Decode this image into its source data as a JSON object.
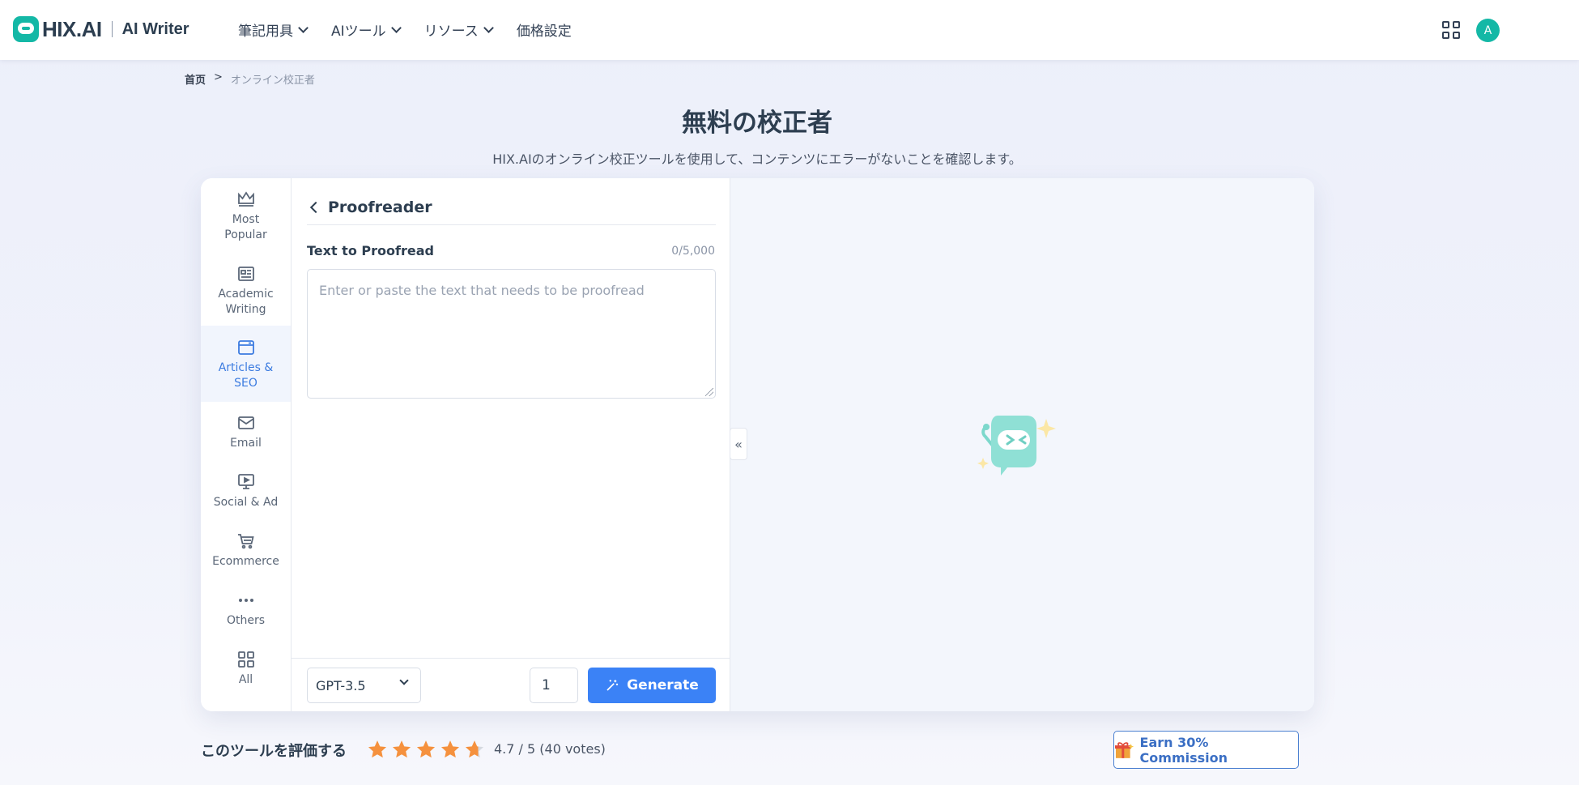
{
  "header": {
    "logo_text": "HIX.AI",
    "product": "AI Writer",
    "nav": [
      {
        "label": "筆記用具"
      },
      {
        "label": "AIツール"
      },
      {
        "label": "リソース"
      },
      {
        "label": "価格設定"
      }
    ],
    "avatar_initial": "A"
  },
  "breadcrumb": {
    "home": "首页",
    "separator": ">",
    "current": "オンライン校正者"
  },
  "page": {
    "title": "無料の校正者",
    "subtitle": "HIX.AIのオンライン校正ツールを使用して、コンテンツにエラーがないことを確認します。"
  },
  "categories": [
    {
      "label1": "Most",
      "label2": "Popular",
      "icon": "crown-icon"
    },
    {
      "label1": "Academic",
      "label2": "Writing",
      "icon": "newspaper-icon"
    },
    {
      "label1": "Articles &",
      "label2": "SEO",
      "icon": "browser-window-icon",
      "active": true
    },
    {
      "label1": "Email",
      "label2": "",
      "icon": "envelope-icon"
    },
    {
      "label1": "Social & Ad",
      "label2": "",
      "icon": "monitor-play-icon"
    },
    {
      "label1": "Ecommerce",
      "label2": "",
      "icon": "cart-icon"
    },
    {
      "label1": "Others",
      "label2": "",
      "icon": "dots-icon"
    },
    {
      "label1": "All",
      "label2": "",
      "icon": "grid-icon"
    }
  ],
  "tool": {
    "name": "Proofreader",
    "field_label": "Text to Proofread",
    "char_count": "0/5,000",
    "placeholder": "Enter or paste the text that needs to be proofread",
    "model": "GPT-3.5",
    "quantity": "1",
    "generate_label": "Generate"
  },
  "rating": {
    "label": "このツールを評価する",
    "score_text": "4.7 / 5 (40 votes)",
    "stars": 4.7
  },
  "earn": {
    "label": "Earn 30% Commission",
    "icon": "gift-icon"
  },
  "colors": {
    "accent": "#3b82f6",
    "brand": "#14b8a6",
    "star": "#f5913e"
  }
}
